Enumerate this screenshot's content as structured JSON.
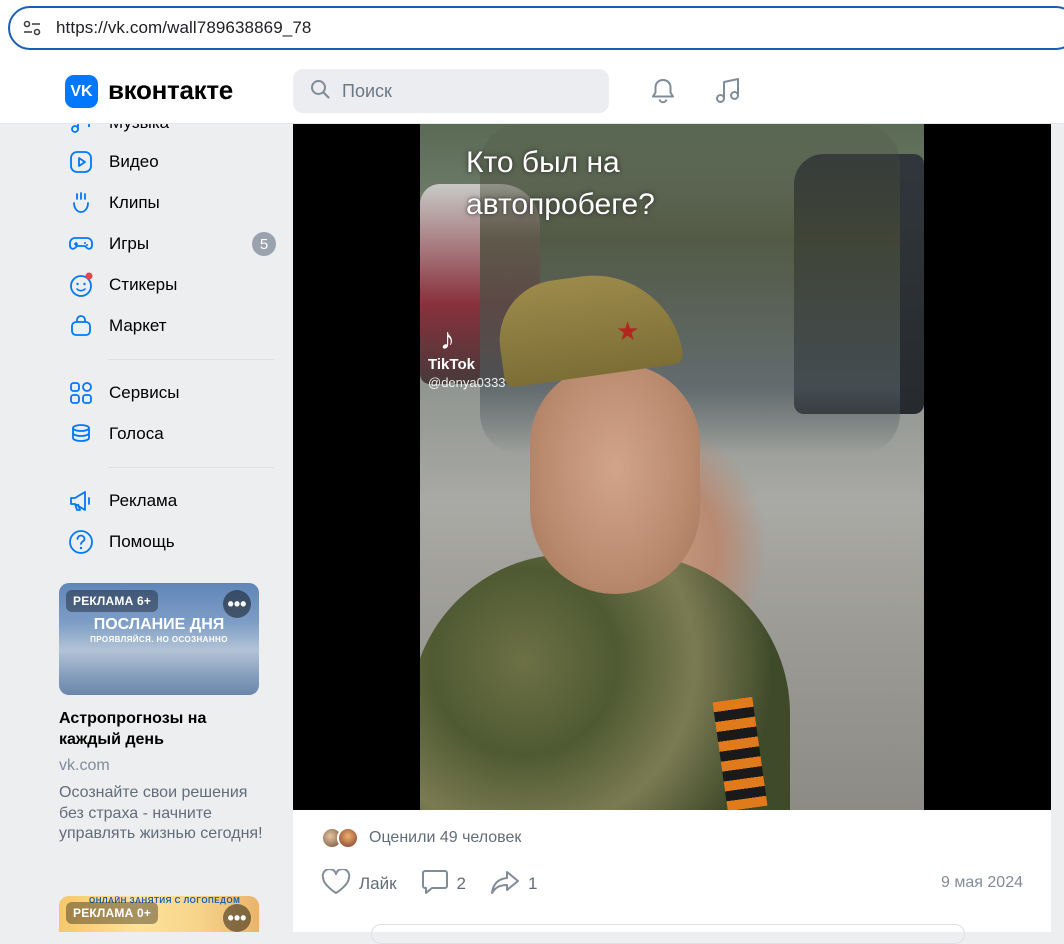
{
  "browser": {
    "url": "https://vk.com/wall789638869_78"
  },
  "header": {
    "logo_mark": "VK",
    "logo_text": "вконтакте",
    "search_placeholder": "Поиск"
  },
  "sidebar": {
    "items": [
      {
        "label": "Музыка",
        "icon": "music-icon"
      },
      {
        "label": "Видео",
        "icon": "video-icon"
      },
      {
        "label": "Клипы",
        "icon": "clips-icon"
      },
      {
        "label": "Игры",
        "icon": "gamepad-icon",
        "badge": "5"
      },
      {
        "label": "Стикеры",
        "icon": "sticker-icon"
      },
      {
        "label": "Маркет",
        "icon": "market-icon"
      },
      {
        "label": "Сервисы",
        "icon": "services-icon"
      },
      {
        "label": "Голоса",
        "icon": "votes-icon"
      },
      {
        "label": "Реклама",
        "icon": "megaphone-icon"
      },
      {
        "label": "Помощь",
        "icon": "help-icon"
      }
    ]
  },
  "ads": [
    {
      "tag": "РЕКЛАМА  6+",
      "headline": "ПОСЛАНИЕ ДНЯ",
      "subheadline": "ПРОЯВЛЯЙСЯ. НО ОСОЗНАННО",
      "title": "Астропрогнозы на каждый день",
      "domain": "vk.com",
      "description": "Осознайте свои решения без страха - начните управлять жизнью сегодня!"
    },
    {
      "tag": "РЕКЛАМА  0+",
      "headline": "ОНЛАЙН ЗАНЯТИЯ С ЛОГОПЕДОМ"
    }
  ],
  "post": {
    "video_caption_line1": "Кто был на",
    "video_caption_line2": "автопробеге?",
    "tiktok_brand": "TikTok",
    "tiktok_user": "@denya0333",
    "liked_text": "Оценили 49 человек",
    "like_label": "Лайк",
    "comments_count": "2",
    "shares_count": "1",
    "date": "9 мая 2024"
  },
  "colors": {
    "accent": "#0077ff",
    "text_secondary": "#626d7a",
    "bg": "#edeef0"
  }
}
